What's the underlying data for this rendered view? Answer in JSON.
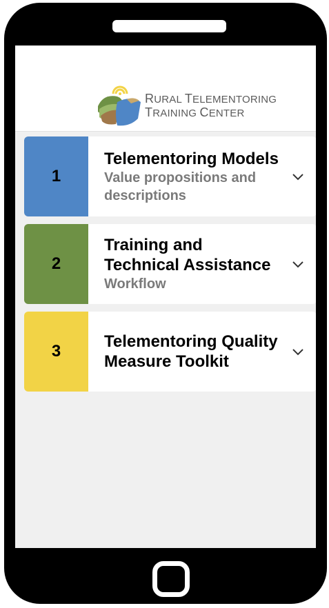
{
  "logo": {
    "line1_first": "R",
    "line1_rest": "URAL ",
    "line1_first2": "T",
    "line1_rest2": "ELEMENTORING",
    "line2_first": "T",
    "line2_rest": "RAINING ",
    "line2_first2": "C",
    "line2_rest2": "ENTER"
  },
  "cards": [
    {
      "number": "1",
      "title": "Telementoring Models",
      "subtitle": "Value propositions and descriptions",
      "color": "#4f86c6"
    },
    {
      "number": "2",
      "title": "Training and Technical Assistance",
      "subtitle": "Workflow",
      "color": "#6e9145"
    },
    {
      "number": "3",
      "title": "Telementoring Quality Measure Toolkit",
      "subtitle": "",
      "color": "#f2d346"
    }
  ],
  "colors": {
    "phone_frame": "#000000",
    "screen_bg": "#f0f0f0",
    "subtitle_gray": "#7a7a7a"
  },
  "icons": {
    "expand": "chevron-down-icon",
    "home": "home-button-icon"
  }
}
